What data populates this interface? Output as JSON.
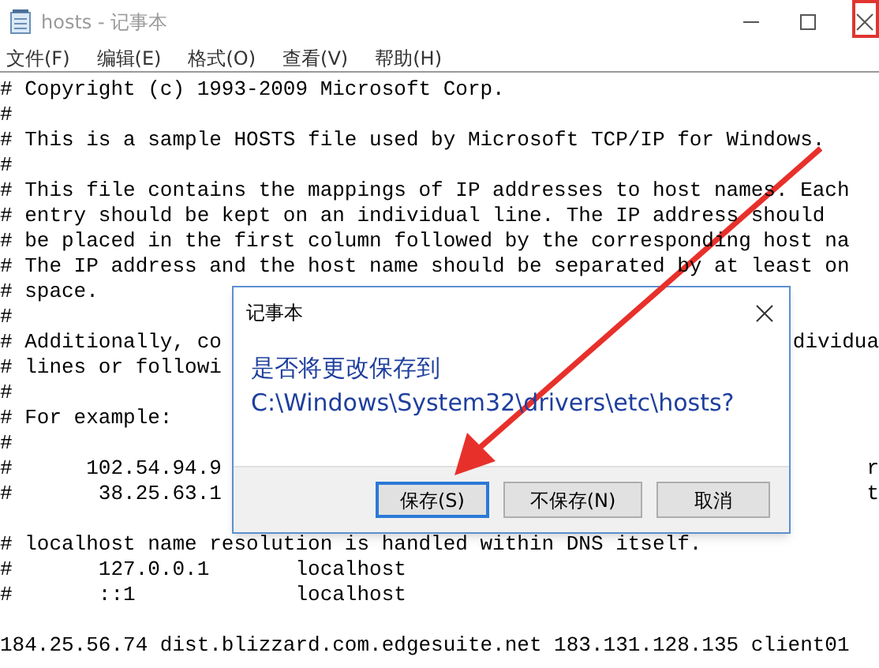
{
  "window": {
    "title": "hosts - 记事本"
  },
  "menu": [
    "文件(F)",
    "编辑(E)",
    "格式(O)",
    "查看(V)",
    "帮助(H)"
  ],
  "editor": {
    "lines": [
      {
        "text": "# Copyright (c) 1993-2009 Microsoft Corp."
      },
      {
        "text": "#"
      },
      {
        "text": "# This is a sample HOSTS file used by Microsoft TCP/IP for Windows."
      },
      {
        "text": "#"
      },
      {
        "text": "# This file contains the mappings of IP addresses to host names. Each"
      },
      {
        "text": "# entry should be kept on an individual line. The IP address should"
      },
      {
        "text": "# be placed in the first column followed by the corresponding host na"
      },
      {
        "text": "# The IP address and the host name should be separated by at least on"
      },
      {
        "text": "# space."
      },
      {
        "text": "#"
      },
      {
        "text": "# Additionally, co",
        "right": "dividua"
      },
      {
        "text": "# lines or followi"
      },
      {
        "text": "#"
      },
      {
        "text": "# For example:"
      },
      {
        "text": "#"
      },
      {
        "text": "#      102.54.94.9",
        "right": "r"
      },
      {
        "text": "#       38.25.63.1",
        "right": "t",
        "blank_after": true
      },
      {
        "text": "# localhost name resolution is handled within DNS itself."
      },
      {
        "text": "#       127.0.0.1       localhost"
      },
      {
        "text": "#       ::1             localhost",
        "blank_after": true
      },
      {
        "text": "184.25.56.74 dist.blizzard.com.edgesuite.net 183.131.128.135 client01"
      }
    ]
  },
  "dialog": {
    "title": "记事本",
    "message": "是否将更改保存到",
    "path": "C:\\Windows\\System32\\drivers\\etc\\hosts?",
    "buttons": [
      {
        "label": "保存(S)",
        "selected": true
      },
      {
        "label": "不保存(N)",
        "selected": false
      },
      {
        "label": "取消",
        "selected": false
      }
    ]
  }
}
